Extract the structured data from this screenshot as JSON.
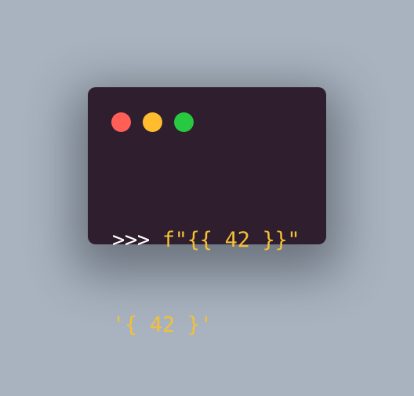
{
  "terminal": {
    "colors": {
      "background": "#2e1e2e",
      "page_background": "#a8b3bf",
      "prompt": "#ffffff",
      "code": "#f5c035"
    },
    "window_controls": [
      {
        "name": "close",
        "color": "#ff5f57"
      },
      {
        "name": "minimize",
        "color": "#febc2e"
      },
      {
        "name": "zoom",
        "color": "#28c840"
      }
    ],
    "lines": [
      {
        "prompt": ">>>",
        "code": "f\"{{ 42 }}\""
      },
      {
        "output": "'{ 42 }'"
      }
    ]
  }
}
